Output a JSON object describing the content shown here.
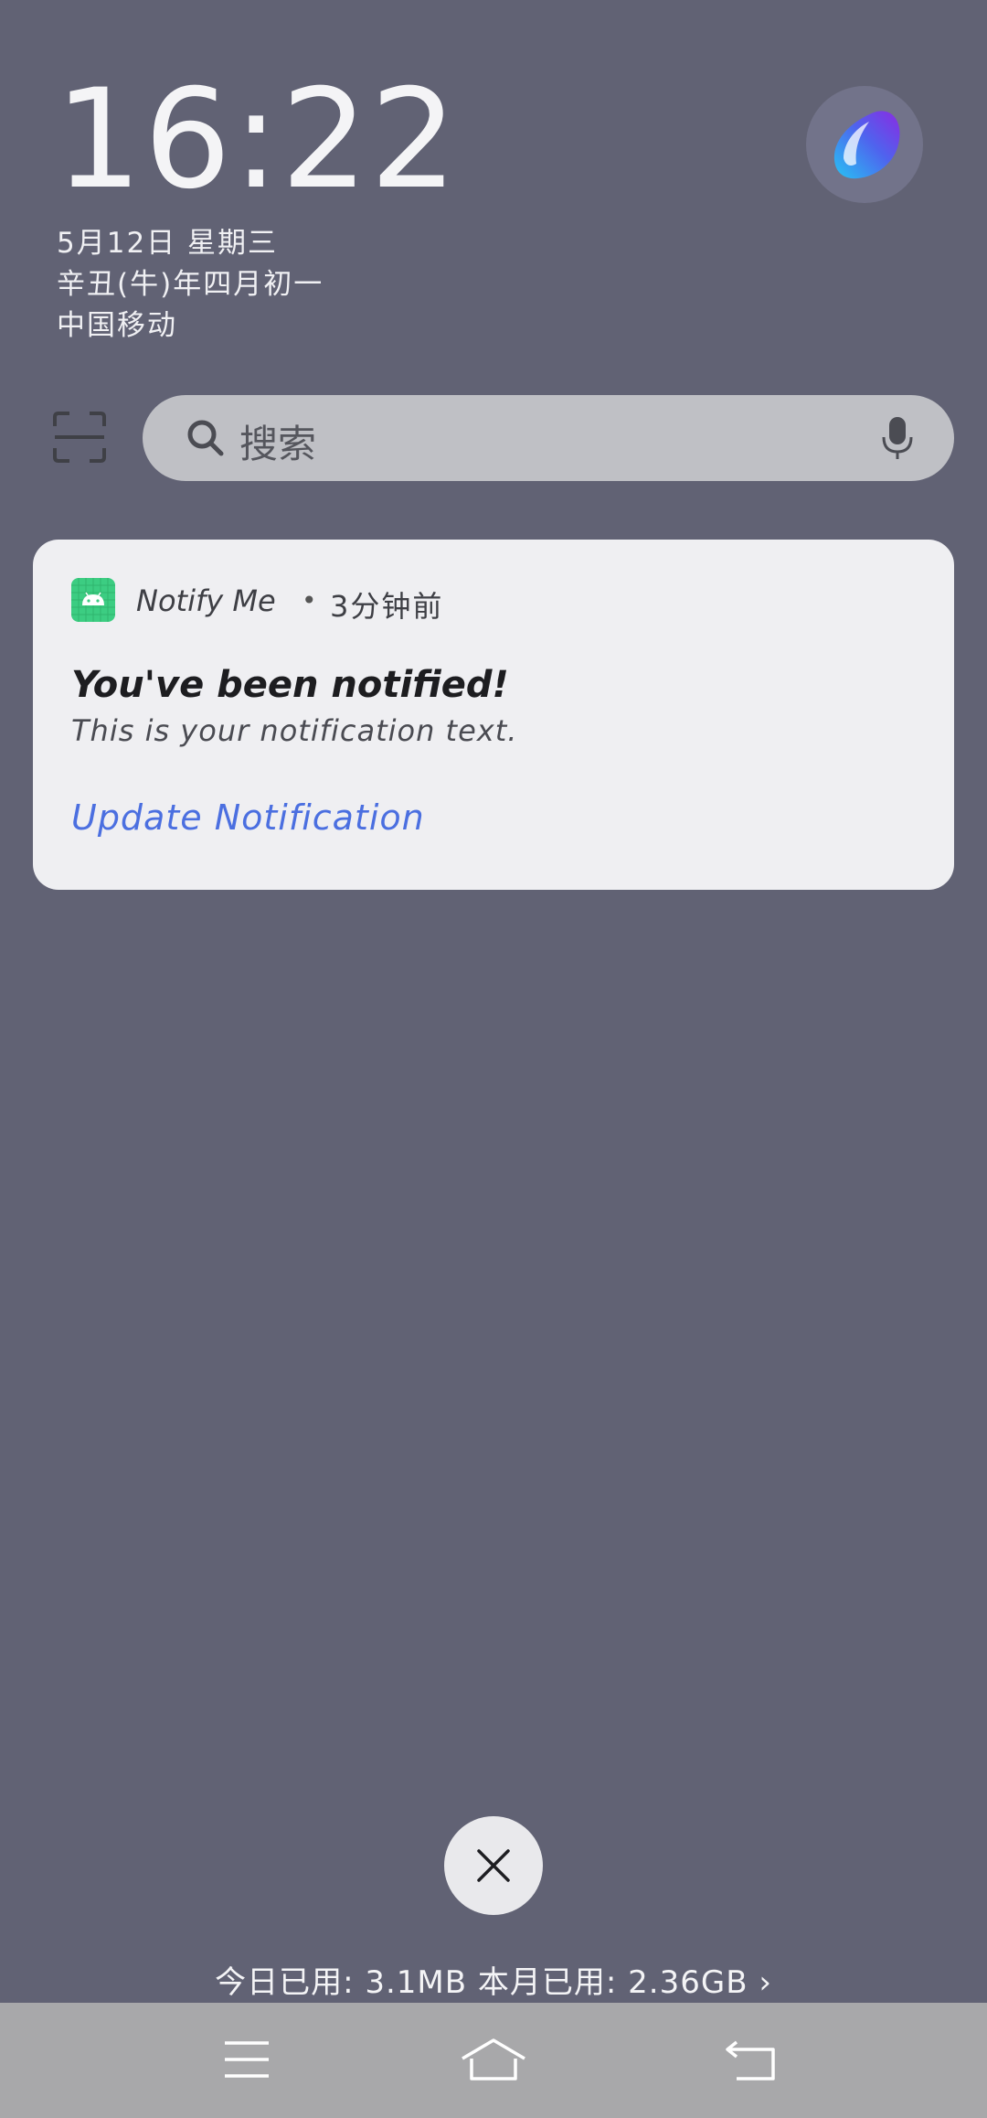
{
  "lockscreen": {
    "time": "16:22",
    "date": "5月12日 星期三",
    "lunar_date": "辛丑(牛)年四月初一",
    "carrier": "中国移动"
  },
  "search": {
    "placeholder": "搜索"
  },
  "notification": {
    "app_name": "Notify Me",
    "separator": "•",
    "time_ago": "3分钟前",
    "title": "You've been notified!",
    "text": "This is your notification text.",
    "action_label": "Update Notification",
    "app_icon_color": "#3ccd82",
    "action_color": "#4b6fe0"
  },
  "bottom": {
    "data_usage": "今日已用: 3.1MB 本月已用: 2.36GB ›"
  },
  "icons": {
    "assistant": "assistant-orb-icon",
    "scan": "scan-icon",
    "search": "search-icon",
    "mic": "mic-icon",
    "close": "close-icon",
    "menu": "menu-icon",
    "home": "home-icon",
    "back": "back-icon"
  },
  "colors": {
    "background": "#616274",
    "navbar": "#a8a8aa"
  }
}
